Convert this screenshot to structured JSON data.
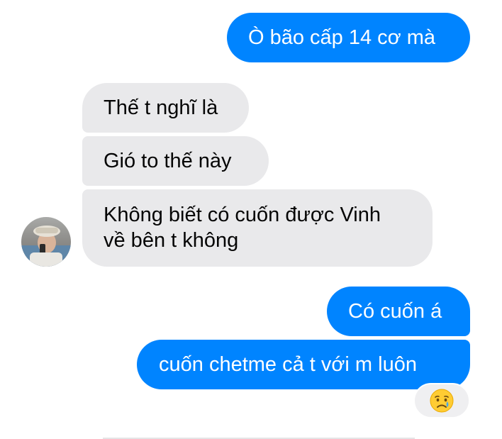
{
  "messages": {
    "sent_1": "Ò bão cấp 14 cơ mà",
    "received_1": "Thế t nghĩ là",
    "received_2": "Gió to thế này",
    "received_3_line1": "Không biết có cuốn được Vinh",
    "received_3_line2": "về bên t không",
    "sent_2": "Có cuốn á",
    "sent_3": "cuốn chetme cả t với m luôn"
  },
  "reaction": {
    "icon": "crying-face-emoji",
    "glyph": "😢"
  },
  "avatar": {
    "icon": "contact-avatar"
  },
  "colors": {
    "sent_bubble": "#0084ff",
    "received_bubble": "#e9e9eb",
    "sent_text": "#ffffff",
    "received_text": "#050505",
    "reaction_bg": "#efeff1"
  }
}
